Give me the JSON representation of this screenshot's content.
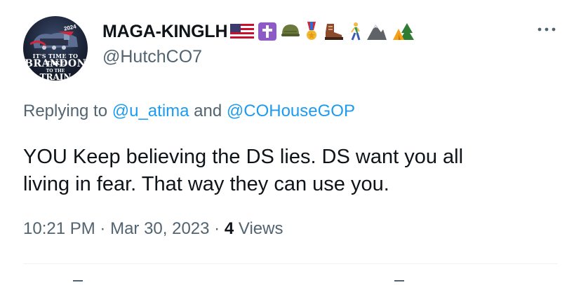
{
  "tweet": {
    "avatar": {
      "year": "2024",
      "banner_top": "IT'S TIME TO TAKE",
      "banner_main": "BRANDON",
      "banner_small": "TO THE",
      "banner_bottom": "TRAIN STATION"
    },
    "author": {
      "display_name": "MAGA-KINGLH",
      "handle": "@HutchCO7",
      "name_emojis": [
        "us-flag",
        "latin-cross",
        "military-helmet",
        "military-medal",
        "hiking-boot",
        "person-walking",
        "mountain",
        "camping-tent"
      ]
    },
    "more_icon": "more-horizontal-icon",
    "reply": {
      "prefix": "Replying to",
      "mention_1": "@u_atima",
      "conjunction": "and",
      "mention_2": "@COHouseGOP"
    },
    "text_line_1": "YOU Keep believing the DS lies. DS want you all",
    "text_line_2": "living in fear. That way they can use you.",
    "meta": {
      "time": "10:21 PM",
      "separator": "·",
      "date": "Mar 30, 2023",
      "views_count": "4",
      "views_label": "Views"
    },
    "colors": {
      "text": "#0f1419",
      "secondary": "#536471",
      "link": "#1d9bf0",
      "divider": "#eff3f4"
    }
  }
}
